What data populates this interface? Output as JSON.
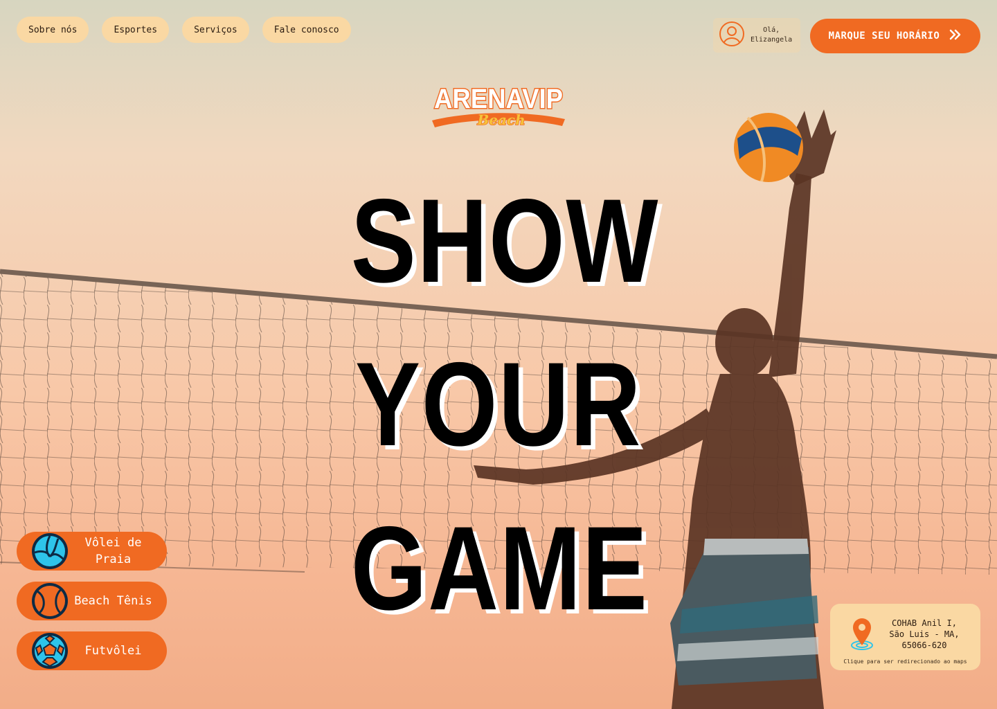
{
  "nav": {
    "items": [
      {
        "label": "Sobre nós"
      },
      {
        "label": "Esportes"
      },
      {
        "label": "Serviços"
      },
      {
        "label": "Fale conosco"
      }
    ]
  },
  "user": {
    "greeting": "Olá,",
    "name": "Elizangela",
    "icon": "user-circle-icon"
  },
  "cta": {
    "label": "MARQUE SEU HORÁRIO",
    "icon": "double-chevron-right-icon"
  },
  "logo": {
    "main": "ARENAVIP",
    "sub": "Beach"
  },
  "hero": {
    "line1": "SHOW",
    "line2": "YOUR",
    "line3": "GAME"
  },
  "sports": [
    {
      "label": "Vôlei de Praia",
      "icon": "volleyball-icon"
    },
    {
      "label": "Beach Tênis",
      "icon": "tennis-ball-icon"
    },
    {
      "label": "Futvôlei",
      "icon": "soccer-ball-icon"
    }
  ],
  "address": {
    "text": "COHAB Anil I, São Luis - MA, 65066-620",
    "hint": "Clique para ser redirecionado ao maps",
    "icon": "map-pin-icon"
  },
  "colors": {
    "accent": "#f06a22",
    "pill": "#fad8a3",
    "sky_top": "#d7d6c0",
    "sky_bottom": "#f2ad88"
  }
}
